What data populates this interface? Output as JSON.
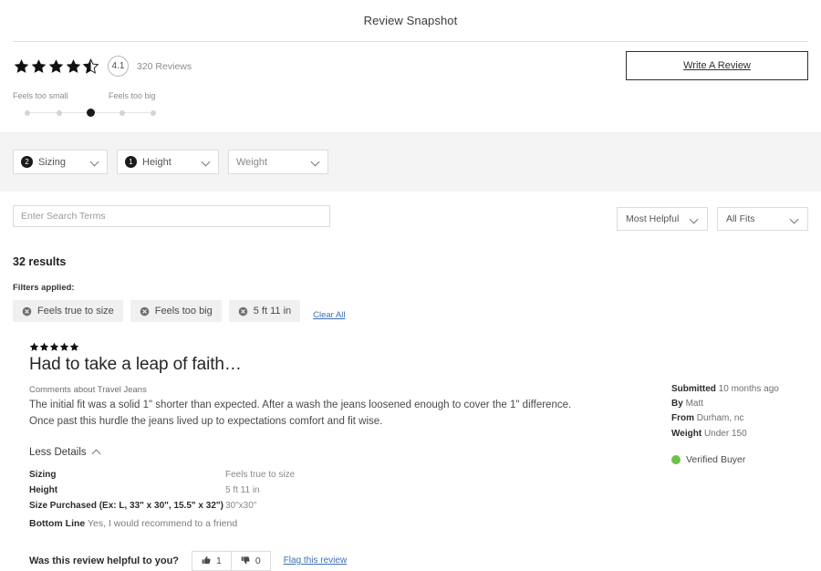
{
  "header": {
    "title": "Review Snapshot"
  },
  "summary": {
    "rating_value": "4.1",
    "stars_full": 4,
    "stars_half": 1,
    "review_count": "320 Reviews",
    "write_review_label": "Write A Review",
    "fit_slider": {
      "left_label": "Feels too small",
      "right_label": "Feels too big",
      "dots": 5,
      "active_index": 3
    }
  },
  "filter_bar": {
    "filters": [
      {
        "label": "Sizing",
        "count": "2",
        "icon": "chevron-down-icon"
      },
      {
        "label": "Height",
        "count": "1",
        "icon": "chevron-down-icon"
      },
      {
        "label": "Weight",
        "count": "",
        "icon": "chevron-down-icon"
      }
    ]
  },
  "search": {
    "placeholder": "Enter Search Terms",
    "value": ""
  },
  "sort": {
    "sort_by": "Most Helpful",
    "fit_filter": "All Fits"
  },
  "results": {
    "count_label": "32 results",
    "filters_applied_label": "Filters applied:",
    "chips": [
      {
        "label": "Feels true to size",
        "icon": "close-circle-icon"
      },
      {
        "label": "Feels too big",
        "icon": "close-circle-icon"
      },
      {
        "label": "5 ft 11 in",
        "icon": "close-circle-icon"
      }
    ],
    "clear_all_label": "Clear All"
  },
  "review": {
    "stars": 5,
    "title": "Had to take a leap of faith…",
    "comments_about": "Comments about Travel Jeans",
    "body": "The initial fit was a solid 1\" shorter than expected. After a wash the jeans loosened enough to cover the 1\" difference. Once past this hurdle the jeans lived up to expectations comfort and fit wise.",
    "details_toggle_label": "Less Details",
    "details": [
      {
        "key": "Sizing",
        "value": "Feels true to size"
      },
      {
        "key": "Height",
        "value": "5 ft 11 in"
      },
      {
        "key": "Size Purchased (Ex: L, 33\" x 30\", 15.5\" x 32\")",
        "value": "30\"x30\""
      }
    ],
    "bottom_line_key": "Bottom Line",
    "bottom_line_value": "Yes, I would recommend to a friend",
    "helpful_question": "Was this review helpful to you?",
    "helpful_up_count": "1",
    "helpful_down_count": "0",
    "flag_label": "Flag this review",
    "meta": {
      "submitted_key": "Submitted",
      "submitted_value": "10 months ago",
      "by_key": "By",
      "by_value": "Matt",
      "from_key": "From",
      "from_value": "Durham, nc",
      "weight_key": "Weight",
      "weight_value": "Under 150",
      "verified_label": "Verified Buyer"
    }
  },
  "colors": {
    "accent_link": "#3b6fb3",
    "verified_green": "#6cc24a",
    "badge_dark": "#1a1a1a",
    "filter_bar_bg": "#f4f4f4"
  }
}
